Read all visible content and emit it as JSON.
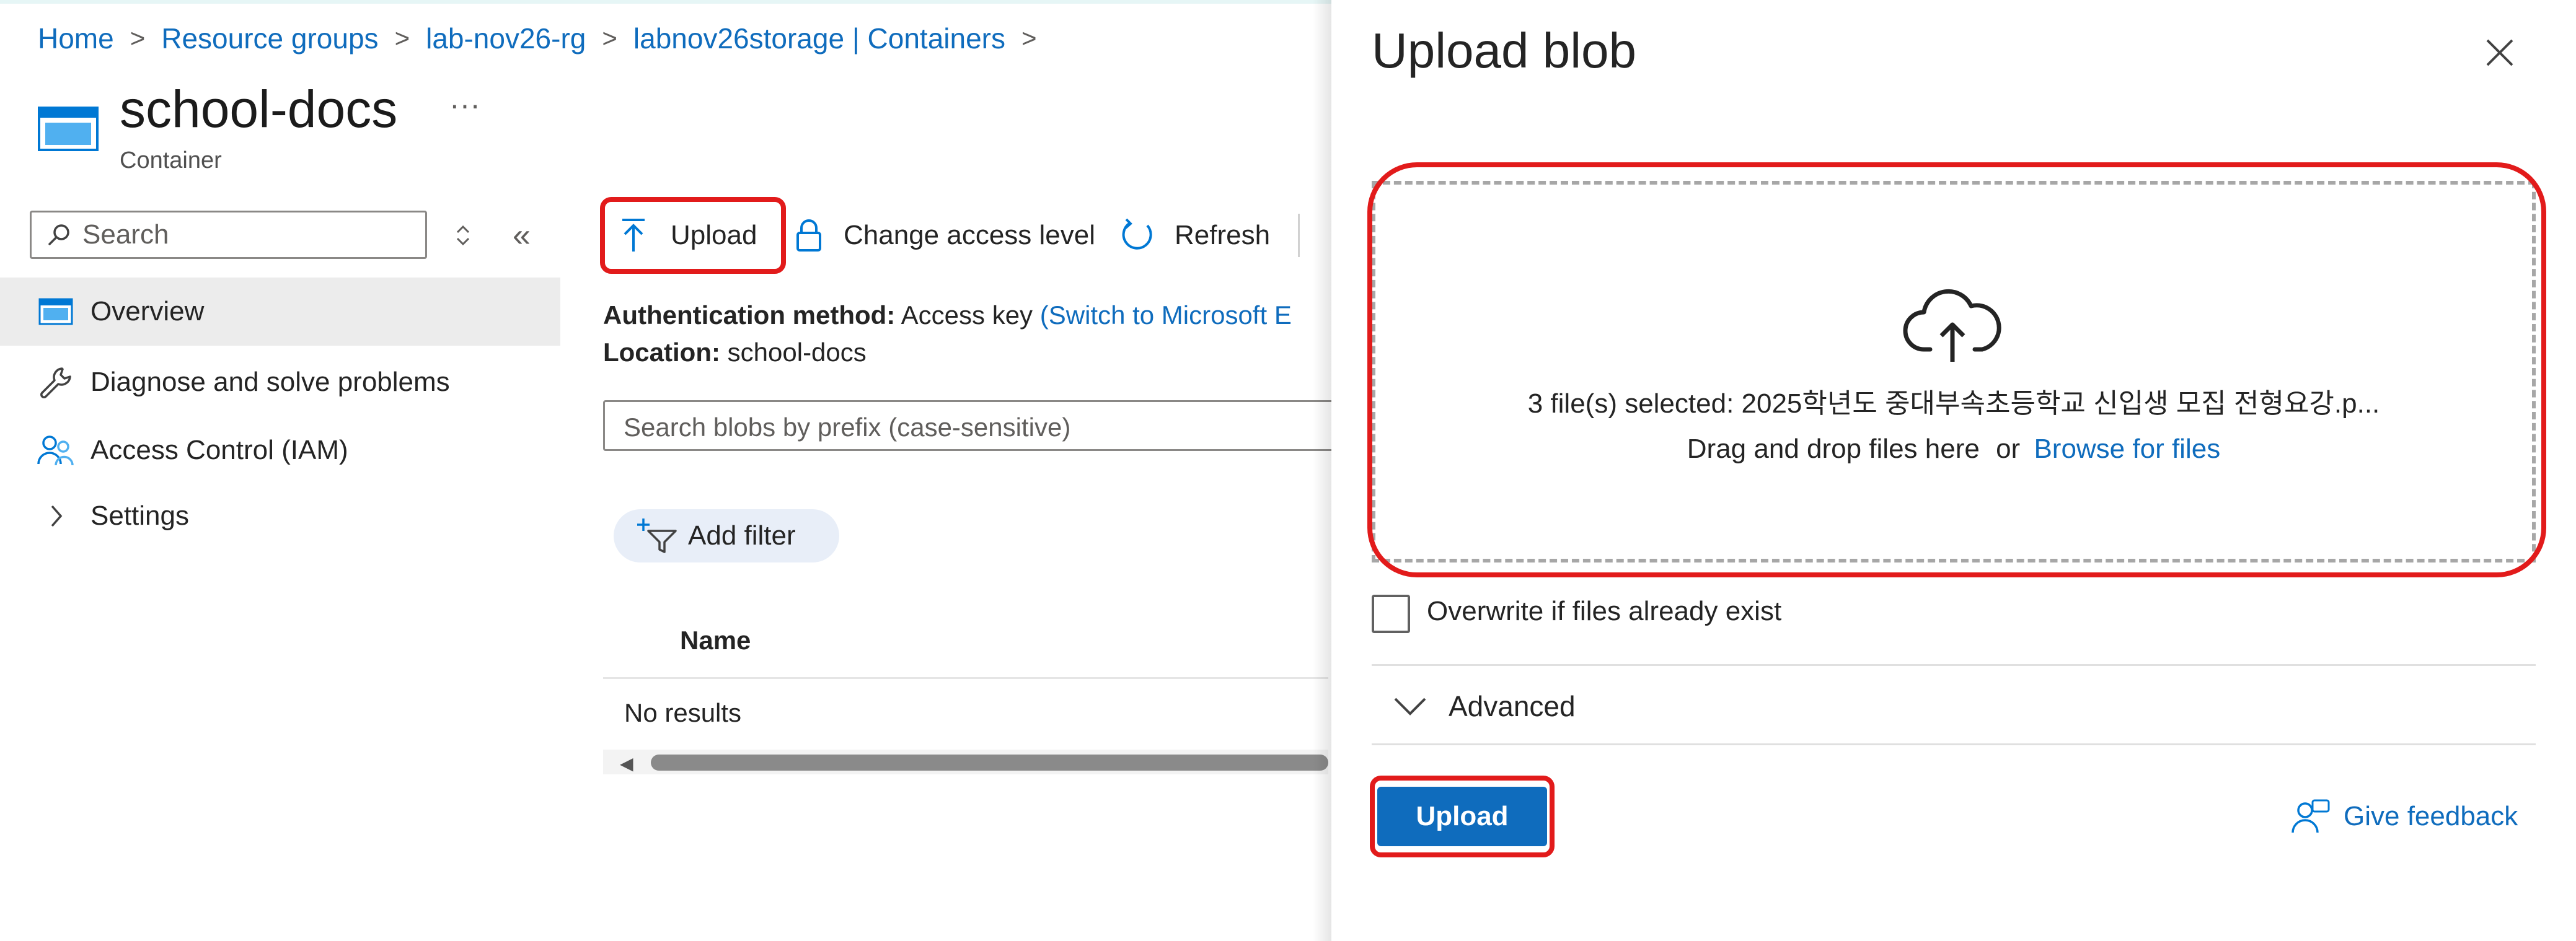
{
  "breadcrumb": {
    "items": [
      "Home",
      "Resource groups",
      "lab-nov26-rg",
      "labnov26storage | Containers"
    ],
    "separator": ">"
  },
  "header": {
    "title": "school-docs",
    "subtitle": "Container",
    "more": "···",
    "icon": "container-icon"
  },
  "sidebar": {
    "search_placeholder": "Search",
    "collapse_glyph": "«",
    "items": [
      {
        "label": "Overview",
        "icon": "overview-icon",
        "active": true
      },
      {
        "label": "Diagnose and solve problems",
        "icon": "wrench-icon"
      },
      {
        "label": "Access Control (IAM)",
        "icon": "people-icon"
      },
      {
        "label": "Settings",
        "icon": "chevron-right-icon"
      }
    ]
  },
  "toolbar": {
    "upload": "Upload",
    "change_access": "Change access level",
    "refresh": "Refresh"
  },
  "details": {
    "auth_label": "Authentication method:",
    "auth_value": "Access key",
    "auth_link": "(Switch to Microsoft E",
    "location_label": "Location:",
    "location_value": "school-docs"
  },
  "blob_list": {
    "search_placeholder": "Search blobs by prefix (case-sensitive)",
    "add_filter": "Add filter",
    "columns": [
      "Name"
    ],
    "empty_text": "No results"
  },
  "upload_panel": {
    "title": "Upload blob",
    "selected_text": "3 file(s) selected: 2025학년도 중대부속초등학교 신입생 모집 전형요강.p...",
    "drag_text": "Drag and drop files here",
    "or_text": "or",
    "browse_link": "Browse for files",
    "overwrite_label": "Overwrite if files already exist",
    "overwrite_checked": false,
    "advanced_label": "Advanced",
    "upload_button": "Upload",
    "feedback_link": "Give feedback"
  },
  "colors": {
    "accent": "#0f6cbd",
    "highlight": "#e21b1b",
    "text": "#242424"
  }
}
